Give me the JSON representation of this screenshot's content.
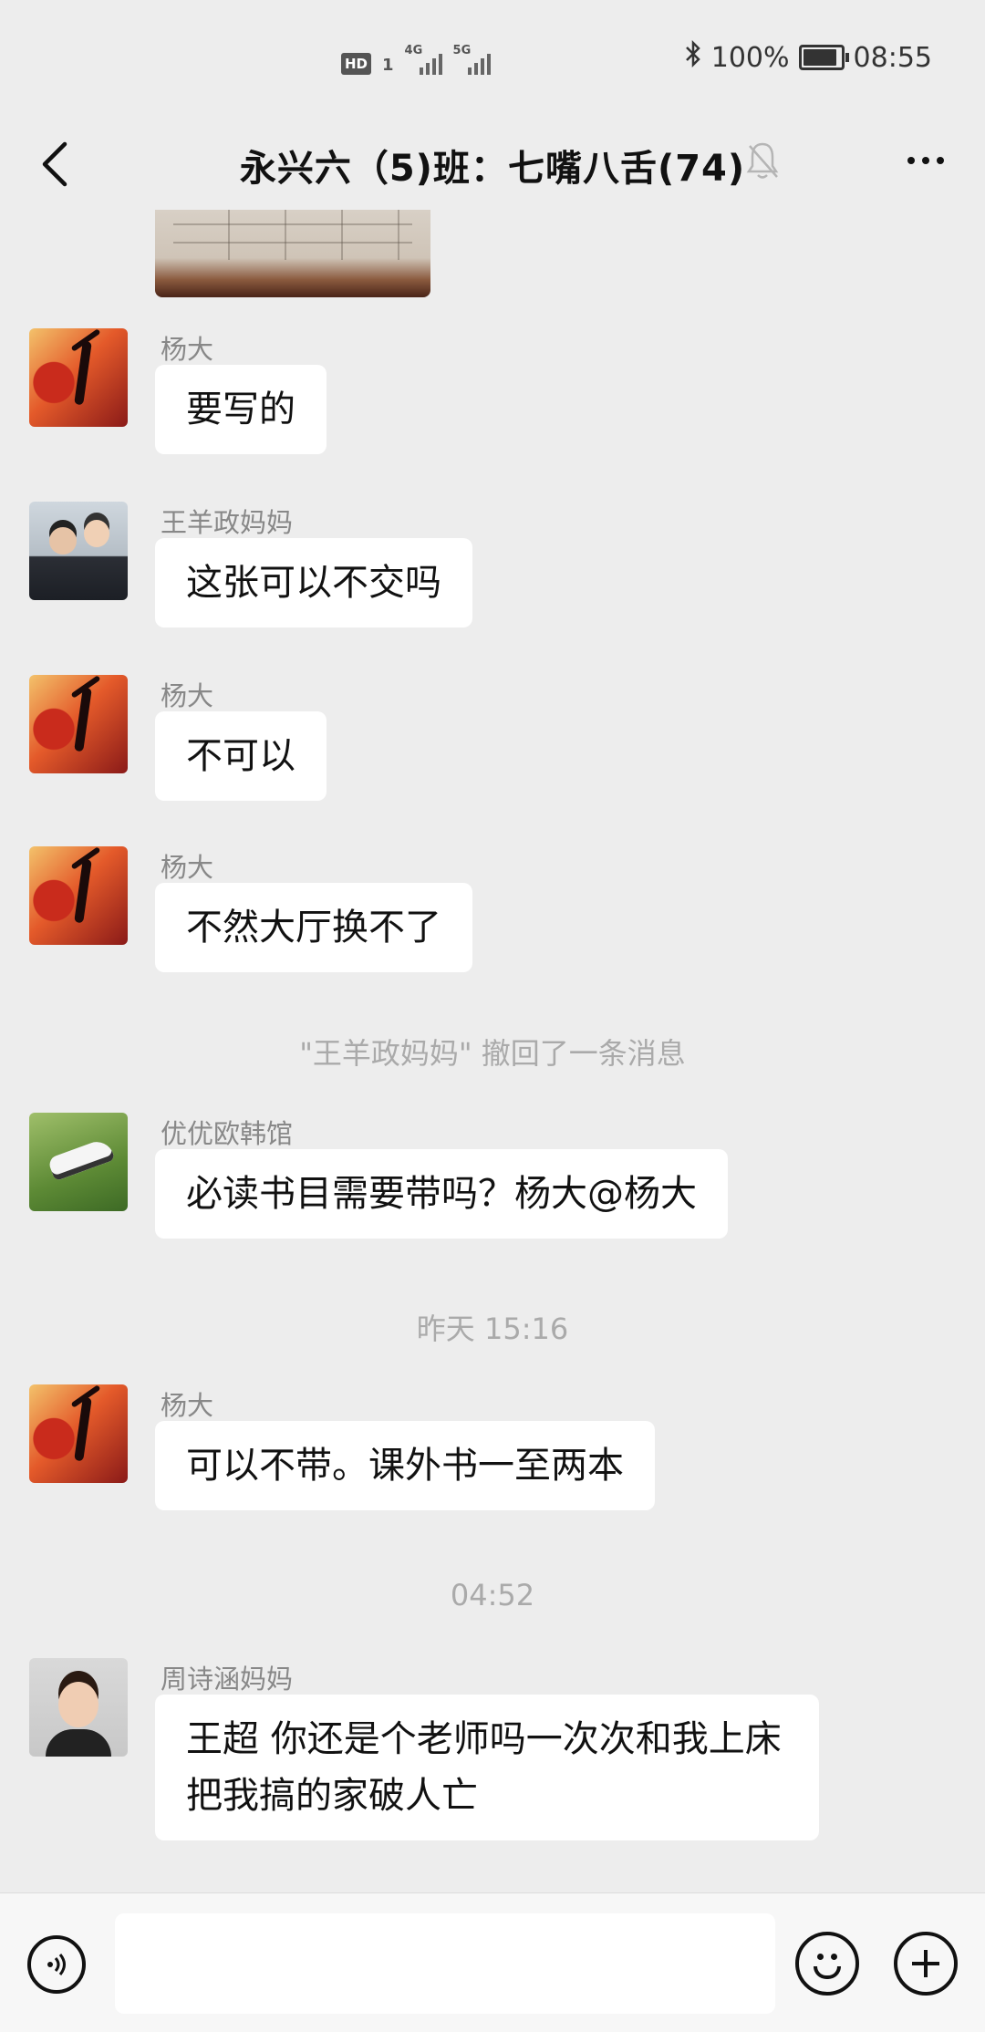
{
  "status_bar": {
    "hd_label": "HD",
    "sim_label": "1",
    "net1_label": "4G",
    "net2_label": "5G",
    "battery_text": "100%",
    "battery_level": 1.0,
    "time": "08:55",
    "bluetooth_icon": "bluetooth-icon"
  },
  "header": {
    "title": "永兴六（5)班：七嘴八舌(74)",
    "back_icon": "chevron-left-icon",
    "mute_icon": "bell-off-icon",
    "more_icon": "more-dots-icon"
  },
  "messages": [
    {
      "type": "image",
      "sender": "",
      "content": ""
    },
    {
      "type": "text",
      "sender": "杨大",
      "text": "要写的"
    },
    {
      "type": "text",
      "sender": "王羊政妈妈",
      "text": "这张可以不交吗"
    },
    {
      "type": "text",
      "sender": "杨大",
      "text": "不可以"
    },
    {
      "type": "text",
      "sender": "杨大",
      "text": "不然大厅换不了"
    },
    {
      "type": "system",
      "text": "\"王羊政妈妈\" 撤回了一条消息"
    },
    {
      "type": "text",
      "sender": "优优欧韩馆",
      "text": "必读书目需要带吗？杨大@杨大"
    },
    {
      "type": "time",
      "text": "昨天 15:16"
    },
    {
      "type": "text",
      "sender": "杨大",
      "text": "可以不带。课外书一至两本"
    },
    {
      "type": "time",
      "text": "04:52"
    },
    {
      "type": "text",
      "sender": "周诗涵妈妈",
      "text": "王超 你还是个老师吗一次次和我上床 把我搞的家破人亡"
    }
  ],
  "input_bar": {
    "voice_icon": "voice-icon",
    "emoji_icon": "emoji-icon",
    "plus_icon": "plus-icon",
    "input_value": ""
  }
}
